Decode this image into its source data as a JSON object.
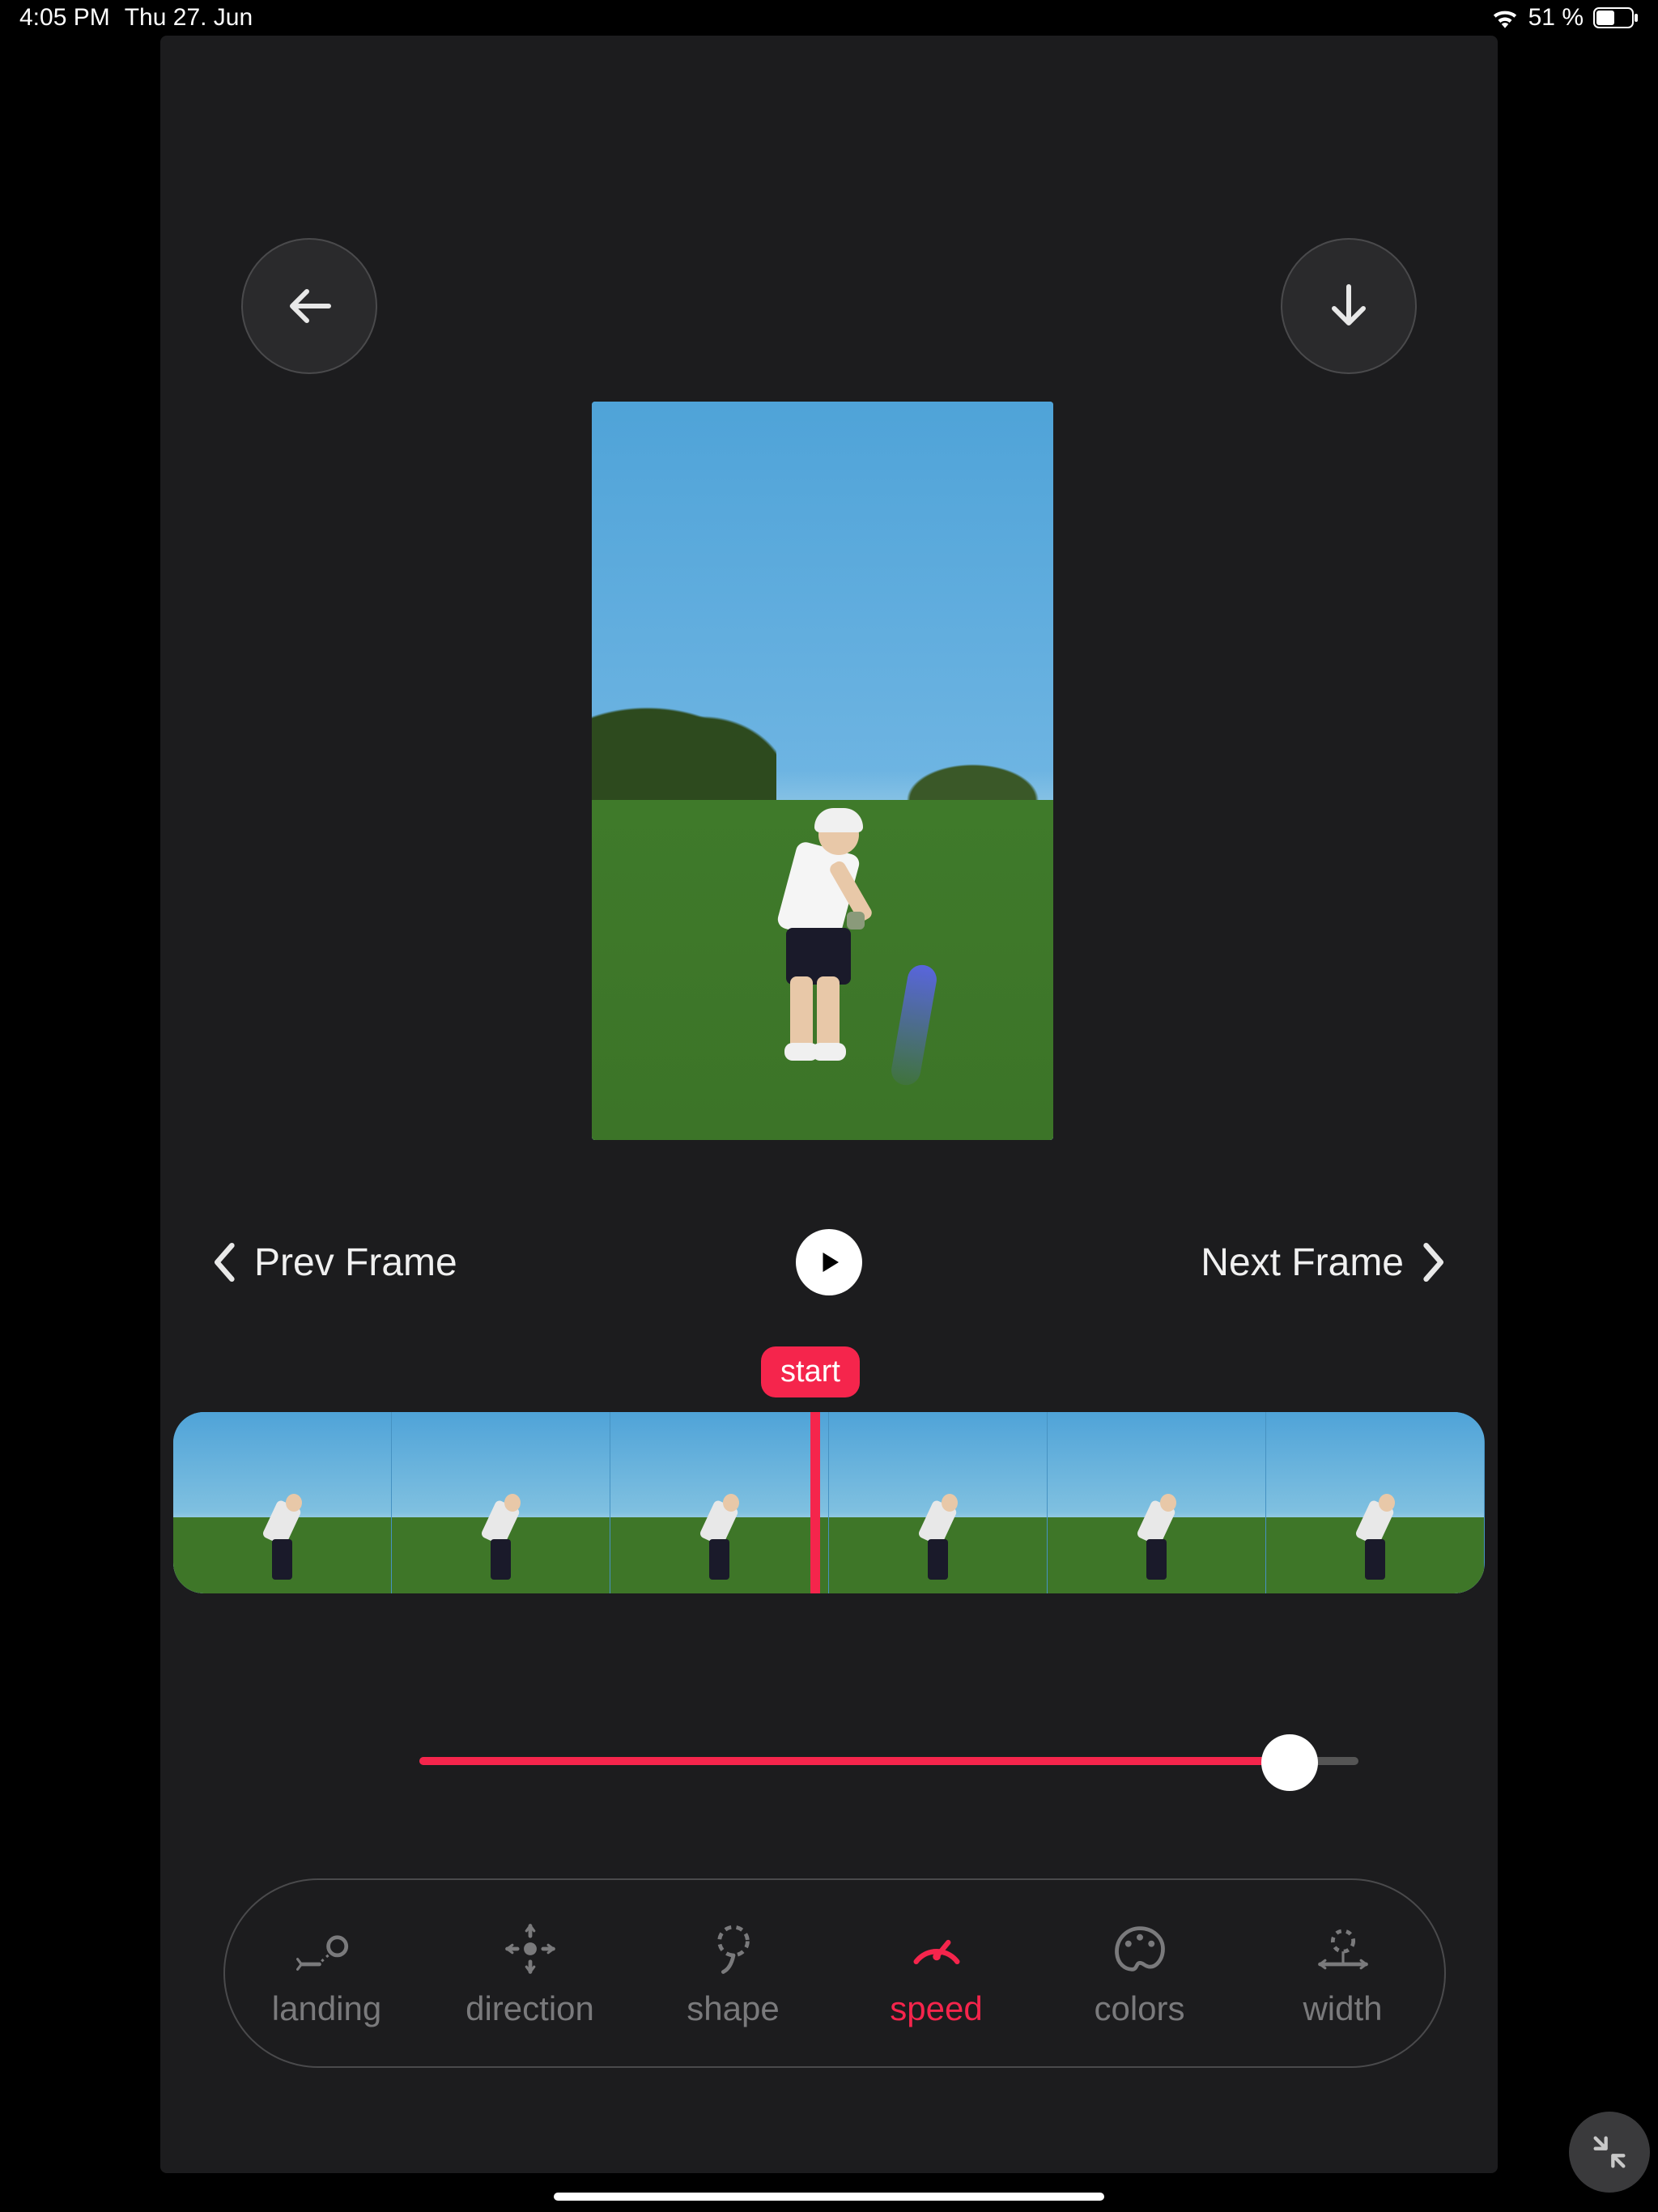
{
  "status": {
    "time": "4:05 PM",
    "date": "Thu 27. Jun",
    "battery": "51 %"
  },
  "nav": {
    "prev": "Prev Frame",
    "next": "Next Frame"
  },
  "marker": {
    "start": "start"
  },
  "slider": {
    "value": 92,
    "max": 100
  },
  "tools": {
    "items": [
      {
        "id": "landing",
        "label": "landing"
      },
      {
        "id": "direction",
        "label": "direction"
      },
      {
        "id": "shape",
        "label": "shape"
      },
      {
        "id": "speed",
        "label": "speed"
      },
      {
        "id": "colors",
        "label": "colors"
      },
      {
        "id": "width",
        "label": "width"
      }
    ],
    "active": "speed"
  },
  "colors": {
    "accent": "#f5254c"
  }
}
